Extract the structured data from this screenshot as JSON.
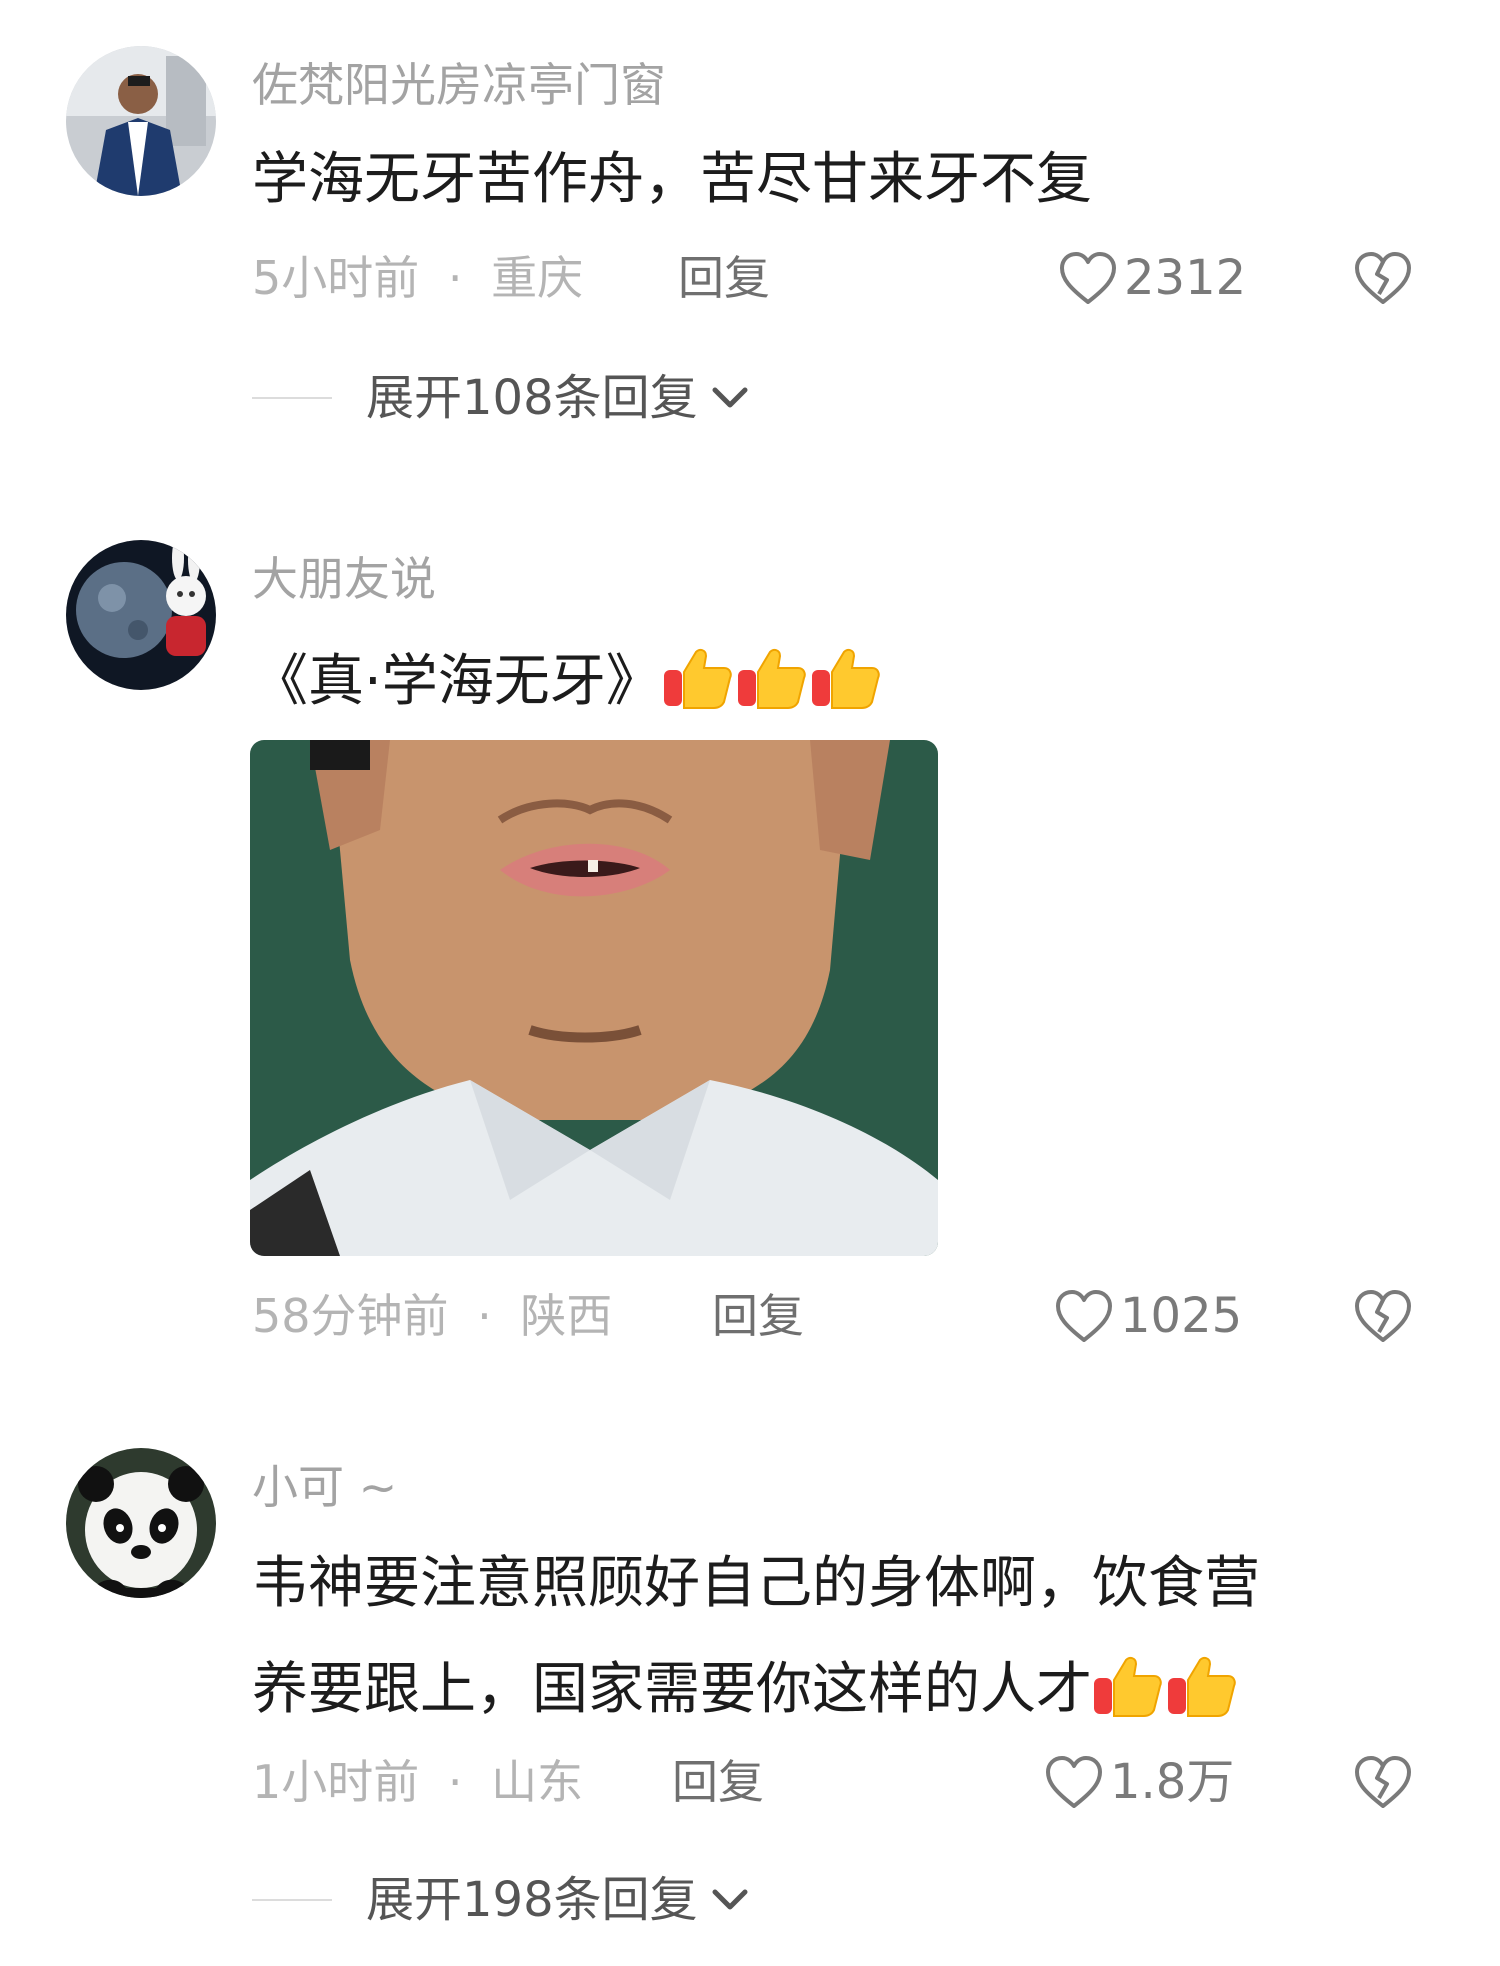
{
  "comments": [
    {
      "username": "佐梵阳光房凉亭门窗",
      "text_lines": [
        "学海无牙苦作舟，苦尽甘来牙不复"
      ],
      "time": "5小时前",
      "location": "重庆",
      "meta_sep": "·",
      "reply_label": "回复",
      "likes": "2312",
      "expand_label": "展开108条回复"
    },
    {
      "username": "大朋友说",
      "text_lines": [
        "《真·学海无牙》"
      ],
      "emoji_count": 3,
      "time": "58分钟前",
      "location": "陕西",
      "meta_sep": "·",
      "reply_label": "回复",
      "likes": "1025"
    },
    {
      "username": "小可 ~",
      "text_lines": [
        "韦神要注意照顾好自己的身体啊，饮食营",
        "养要跟上，国家需要你这样的人才"
      ],
      "emoji_count": 2,
      "time": "1小时前",
      "location": "山东",
      "meta_sep": "·",
      "reply_label": "回复",
      "likes": "1.8万",
      "expand_label": "展开198条回复"
    }
  ],
  "icons": {
    "like": "heart-outline-icon",
    "dislike": "broken-heart-icon",
    "expand": "chevron-down-icon",
    "emoji": "thumbs-up-emoji-icon"
  }
}
